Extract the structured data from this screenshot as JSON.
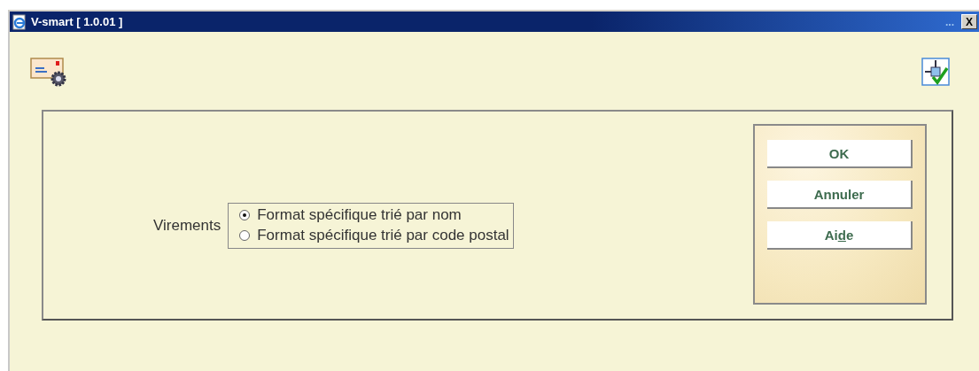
{
  "window": {
    "title": "V-smart [ 1.0.01 ]",
    "overflow": "...",
    "close": "X"
  },
  "form": {
    "label": "Virements",
    "options": [
      {
        "label": "Format spécifique trié par nom",
        "selected": true
      },
      {
        "label": "Format spécifique trié par code postal",
        "selected": false
      }
    ]
  },
  "buttons": [
    {
      "label_parts": [
        "OK"
      ]
    },
    {
      "label_parts": [
        "Annuler"
      ]
    },
    {
      "label_parts": [
        "Ai",
        "d",
        "e"
      ]
    }
  ]
}
